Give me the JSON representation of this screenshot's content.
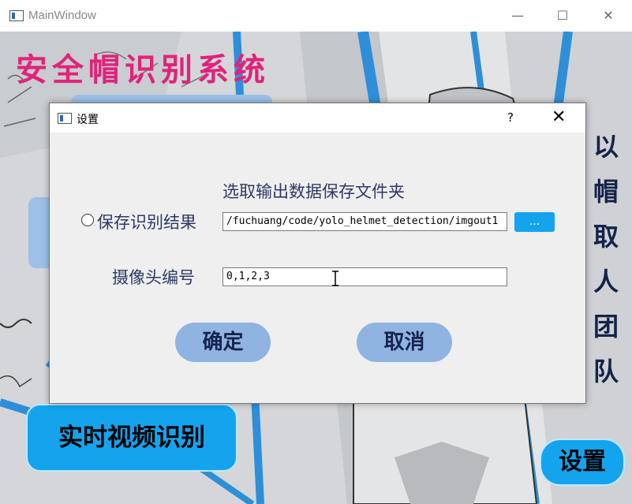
{
  "window": {
    "title": "MainWindow",
    "minimize_symbol": "—",
    "maximize_symbol": "☐",
    "close_symbol": "✕"
  },
  "app": {
    "title": "安全帽识别系统",
    "slogan": [
      "以",
      "帽",
      "取",
      "人",
      "团",
      "队"
    ],
    "realtime_button": "实时视频识别",
    "settings_button": "设置"
  },
  "dialog": {
    "title": "设置",
    "help_symbol": "?",
    "close_symbol": "✕",
    "folder_prompt": "选取输出数据保存文件夹",
    "save_result_label": "保存识别结果",
    "save_result_checked": false,
    "path_value": "/fuchuang/code/yolo_helmet_detection/imgout1",
    "browse_label": "...",
    "camera_label": "摄像头编号",
    "camera_value": "0,1,2,3",
    "ok_label": "确定",
    "cancel_label": "取消"
  },
  "colors": {
    "title_pink": "#e0237a",
    "accent_blue": "#14a4ee",
    "pill_blue": "#8fb4e2",
    "label_navy": "#2e3a66"
  }
}
